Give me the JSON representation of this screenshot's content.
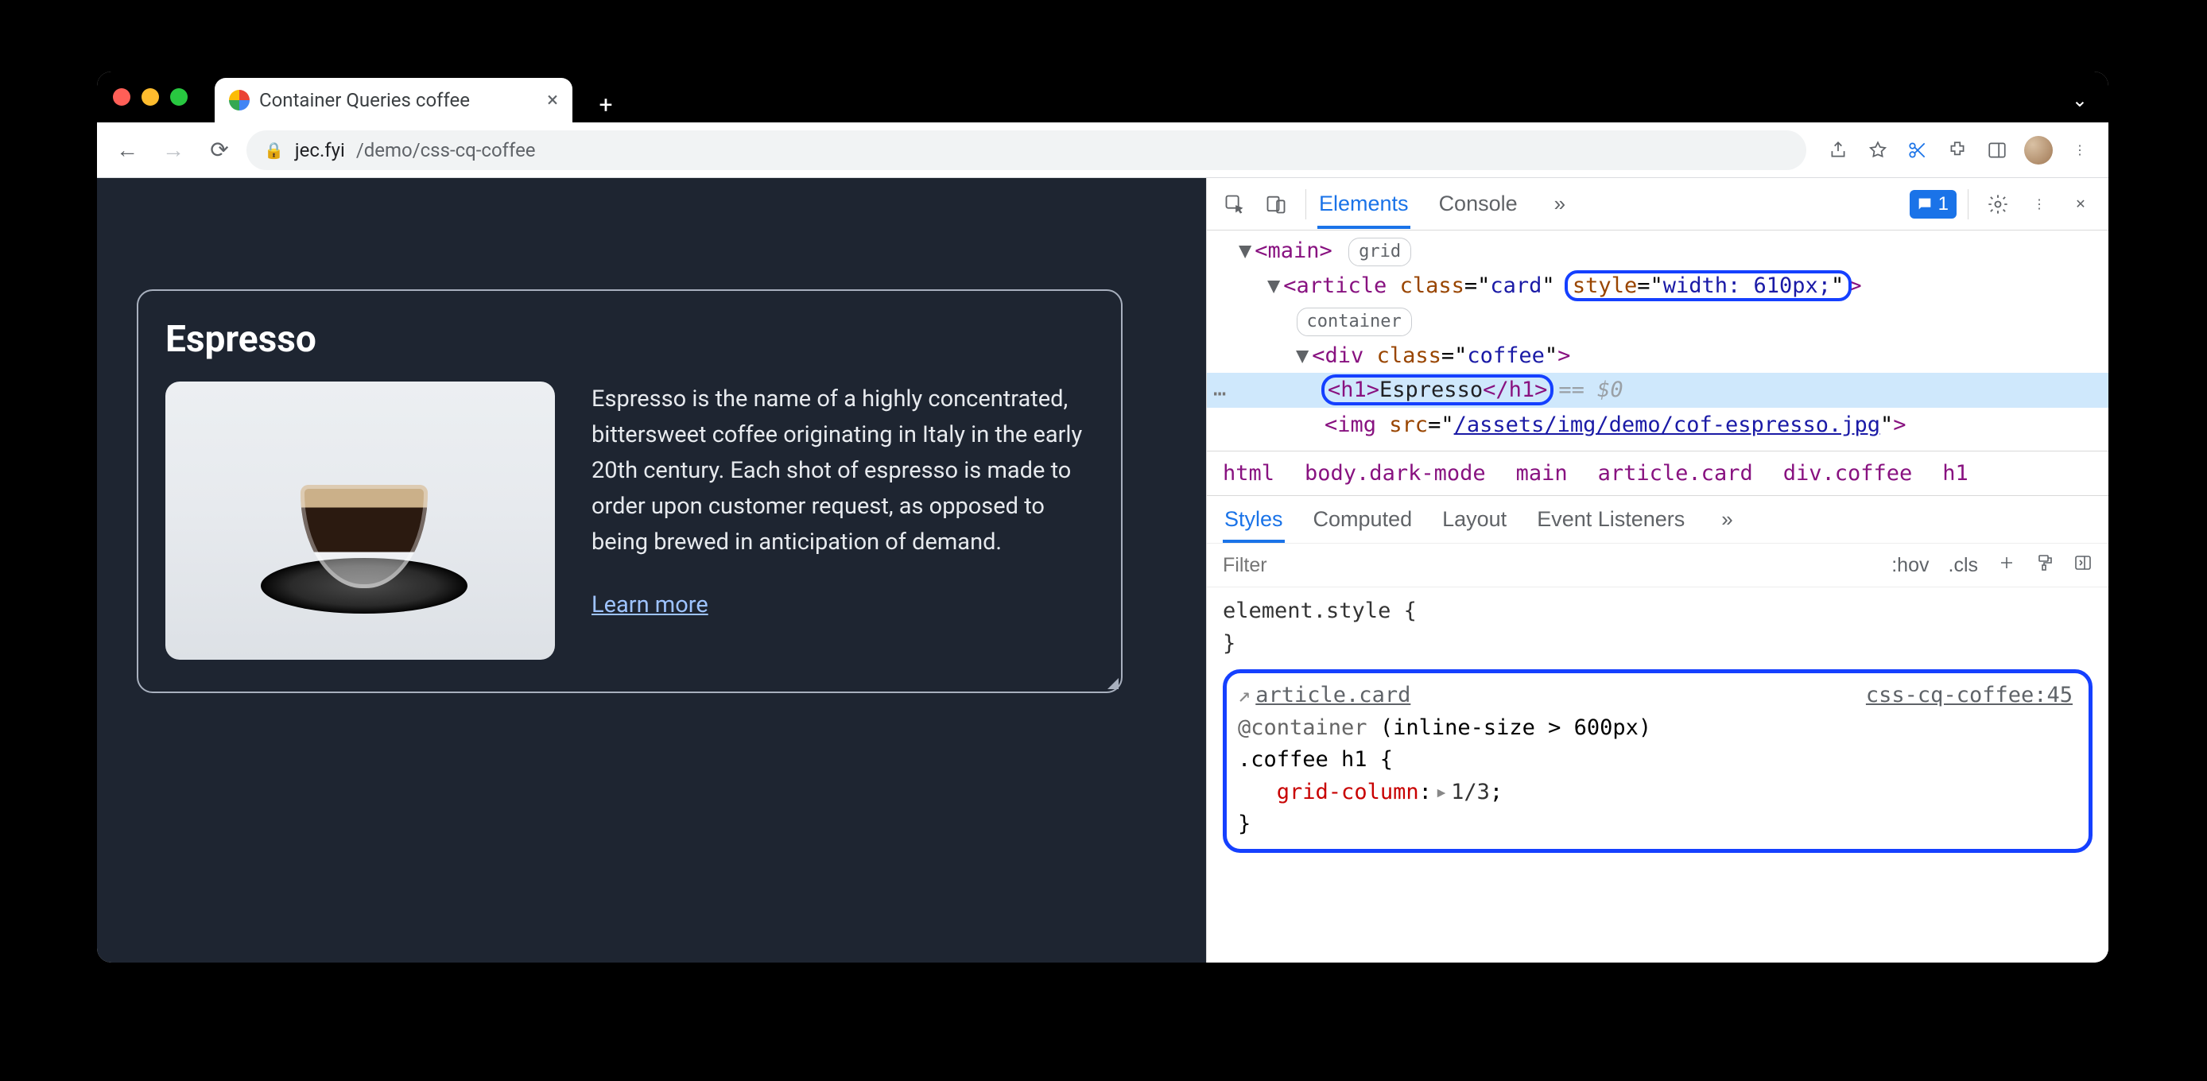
{
  "browser": {
    "tab_title": "Container Queries coffee",
    "url_domain": "jec.fyi",
    "url_path": "/demo/css-cq-coffee",
    "issue_count": "1"
  },
  "page": {
    "heading": "Espresso",
    "paragraph": "Espresso is the name of a highly concentrated, bittersweet coffee originating in Italy in the early 20th century. Each shot of espresso is made to order upon customer request, as opposed to being brewed in anticipation of demand.",
    "learn_more": "Learn more"
  },
  "devtools": {
    "tabs": {
      "elements": "Elements",
      "console": "Console"
    },
    "dom": {
      "main_badge": "grid",
      "article_class": "card",
      "article_style": "width: 610px;",
      "article_badge": "container",
      "div_class": "coffee",
      "h1_text": "Espresso",
      "eq": "== $0",
      "img_src": "/assets/img/demo/cof-espresso.jpg"
    },
    "breadcrumb": {
      "html": "html",
      "body": "body.dark-mode",
      "main": "main",
      "article": "article.card",
      "div": "div.coffee",
      "h1": "h1"
    },
    "styles_tabs": {
      "styles": "Styles",
      "computed": "Computed",
      "layout": "Layout",
      "event": "Event Listeners"
    },
    "filter_placeholder": "Filter",
    "hov": ":hov",
    "cls": ".cls",
    "element_style": "element.style {",
    "element_style_close": "}",
    "rule": {
      "arrow_target": "article.card",
      "container": "@container",
      "query": "(inline-size > 600px)",
      "selector": ".coffee h1 {",
      "prop": "grid-column",
      "val": "1/3",
      "close": "}",
      "source": "css-cq-coffee:45"
    }
  }
}
